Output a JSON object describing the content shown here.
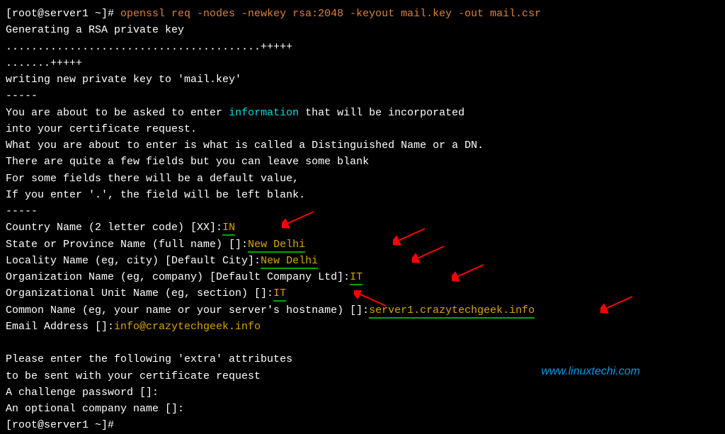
{
  "prompt1_prefix": "[root@server1 ~]# ",
  "command": "openssl req -nodes -newkey rsa:2048 -keyout mail.key -out mail.csr",
  "out_generating": "Generating a RSA private key",
  "out_dots1": "........................................+++++",
  "out_dots2": ".......+++++",
  "out_writing": "writing new private key to 'mail.key'",
  "out_dashes": "-----",
  "out_intro1a": "You are about to be asked to enter ",
  "out_intro1b": "information",
  "out_intro1c": " that will be incorporated",
  "out_intro2": "into your certificate request.",
  "out_intro3": "What you are about to enter is what is called a Distinguished Name or a DN.",
  "out_intro4": "There are quite a few fields but you can leave some blank",
  "out_intro5": "For some fields there will be a default value,",
  "out_intro6": "If you enter '.', the field will be left blank.",
  "field_country_label": "Country Name (2 letter code) [XX]:",
  "field_country_value": "IN",
  "field_state_label": "State or Province Name (full name) []:",
  "field_state_value": "New Delhi",
  "field_city_label": "Locality Name (eg, city) [Default City]:",
  "field_city_value": "New Delhi",
  "field_org_label": "Organization Name (eg, company) [Default Company Ltd]:",
  "field_org_value": "IT",
  "field_ou_label": "Organizational Unit Name (eg, section) []:",
  "field_ou_value": "IT",
  "field_cn_label": "Common Name (eg, your name or your server's hostname) []:",
  "field_cn_value": "server1.crazytechgeek.info",
  "field_email_label": "Email Address []:",
  "field_email_value": "info@crazytechgeek.info",
  "extra1": "Please enter the following 'extra' attributes",
  "extra2": "to be sent with your certificate request",
  "extra_challenge": "A challenge password []:",
  "extra_company": "An optional company name []:",
  "prompt2_prefix": "[root@server1 ~]# ",
  "watermark": "www.linuxtechi.com"
}
